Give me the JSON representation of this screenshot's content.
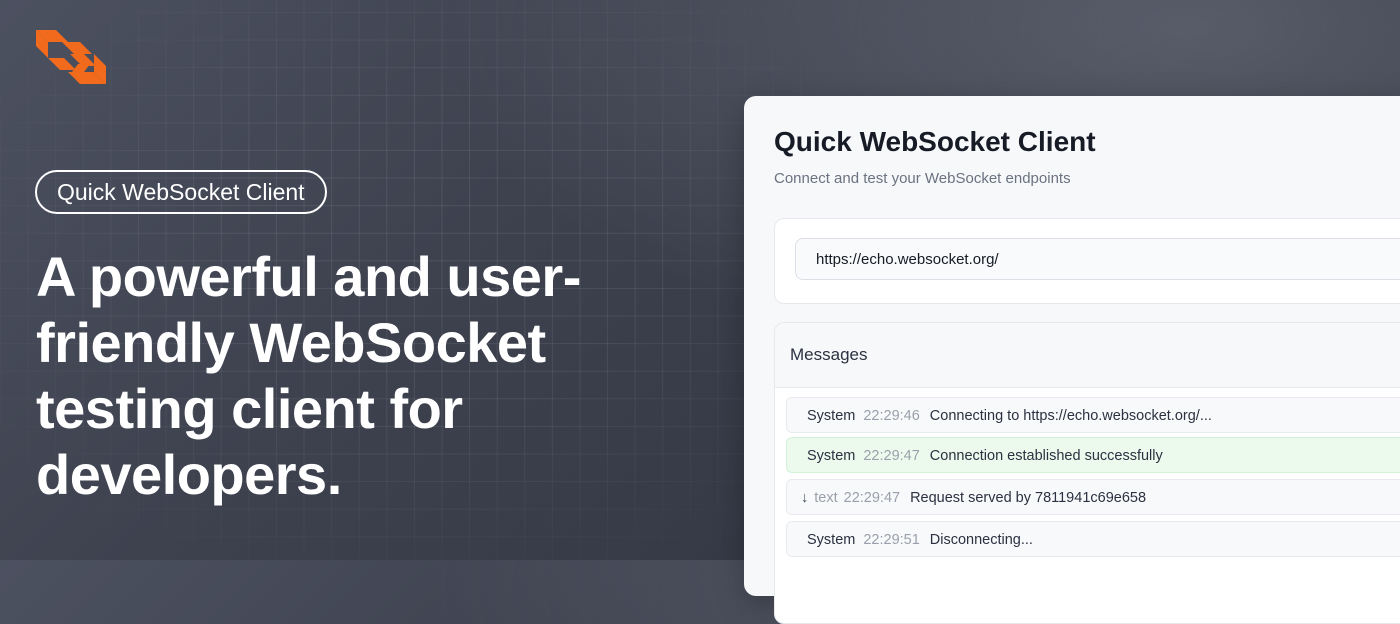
{
  "brand": {
    "logo_icon": "websocket-logo-icon",
    "accent_color": "#f26b1d"
  },
  "hero": {
    "badge": "Quick WebSocket Client",
    "headline": "A powerful and user-friendly WebSocket testing client for developers."
  },
  "app": {
    "title": "Quick WebSocket Client",
    "subtitle": "Connect and test your WebSocket endpoints",
    "url_value": "https://echo.websocket.org/",
    "messages_title": "Messages",
    "messages": [
      {
        "source": "System",
        "arrow": "",
        "time": "22:29:46",
        "text": "Connecting to https://echo.websocket.org/...",
        "status": "info"
      },
      {
        "source": "System",
        "arrow": "",
        "time": "22:29:47",
        "text": "Connection established successfully",
        "status": "success"
      },
      {
        "source": "text",
        "arrow": "↓",
        "time": "22:29:47",
        "text": "Request served by 7811941c69e658",
        "status": "incoming"
      },
      {
        "source": "System",
        "arrow": "",
        "time": "22:29:51",
        "text": "Disconnecting...",
        "status": "info"
      }
    ]
  }
}
